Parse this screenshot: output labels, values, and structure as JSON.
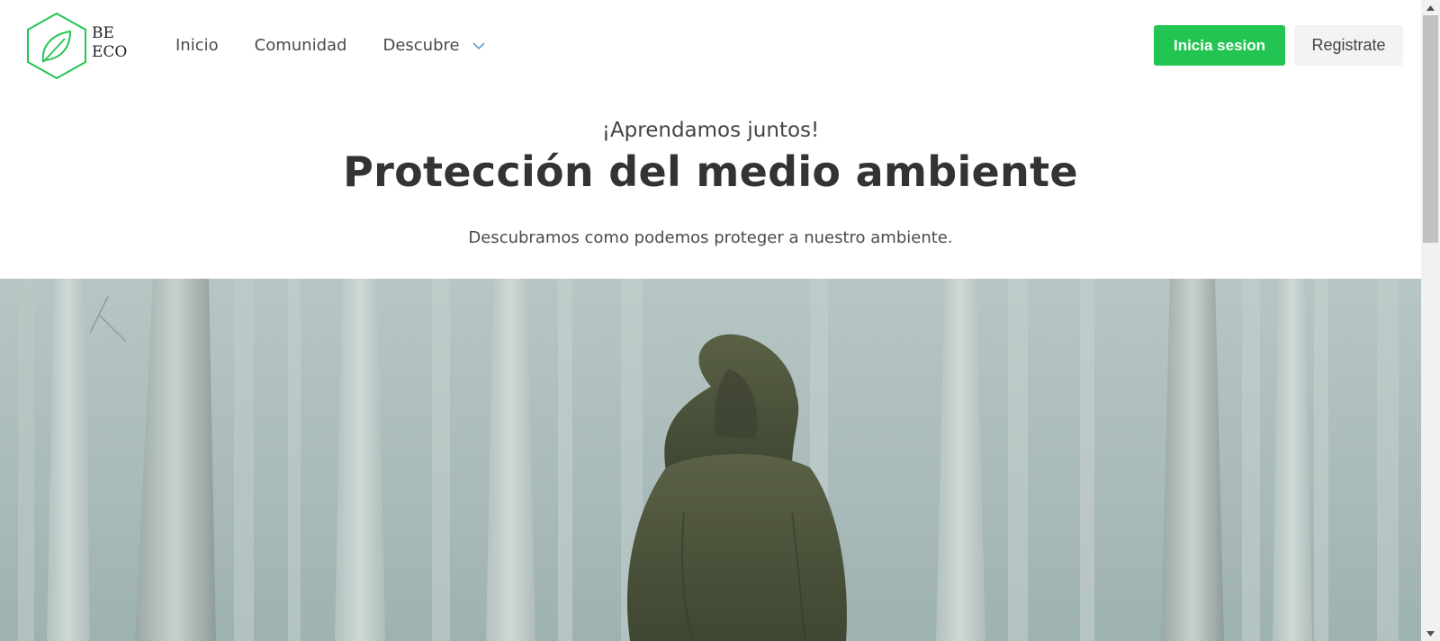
{
  "brand": {
    "logo_line1": "BE",
    "logo_line2": "ECO",
    "accent_color": "#23c552"
  },
  "nav": {
    "items": [
      {
        "label": "Inicio"
      },
      {
        "label": "Comunidad"
      },
      {
        "label": "Descubre"
      }
    ],
    "login_label": "Inicia sesion",
    "register_label": "Registrate"
  },
  "hero": {
    "subtitle": "¡Aprendamos juntos!",
    "title": "Protección del medio ambiente",
    "description": "Descubramos como podemos proteger a nuestro ambiente."
  },
  "icons": {
    "logo": "leaf-hexagon-icon",
    "dropdown": "chevron-down-icon",
    "scroll_up": "arrow-up-icon",
    "scroll_down": "arrow-down-icon"
  }
}
